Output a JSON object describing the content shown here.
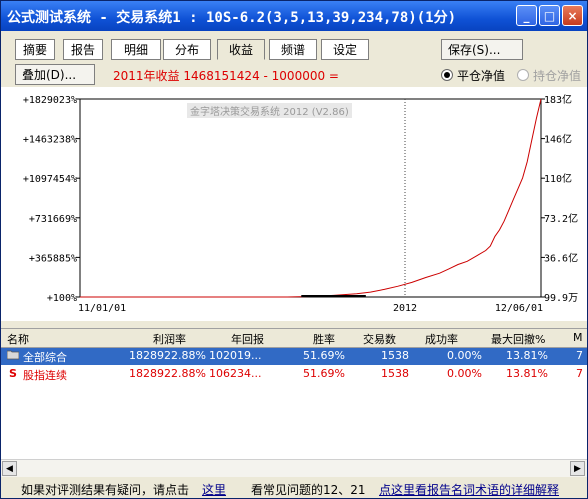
{
  "window": {
    "title": "公式测试系统 - 交易系统1 : 10S-6.2(3,5,13,39,234,78)(1分)",
    "controls": [
      "_",
      "□",
      "×"
    ]
  },
  "tabs": [
    "摘要",
    "报告",
    "明细",
    "分布",
    "收益",
    "频谱",
    "设定"
  ],
  "active_tab": "收益",
  "save_button": "保存(S)...",
  "overlay_button": "叠加(D)...",
  "income_text": "2011年收益 1468151424 - 1000000 =",
  "radio": [
    {
      "label": "平仓净值",
      "checked": true,
      "enabled": true
    },
    {
      "label": "持仓净值",
      "checked": false,
      "enabled": false
    }
  ],
  "chart_data": {
    "type": "line",
    "watermark": "金字塔决策交易系统 2012 (V2.86)",
    "y_ticks_left": [
      "+1829023%",
      "+1463238%",
      "+1097454%",
      "+731669%",
      "+365885%",
      "+100%"
    ],
    "y_ticks_right": [
      "183亿",
      "146亿",
      "110亿",
      "73.2亿",
      "36.6亿",
      "99.9万"
    ],
    "x_ticks": [
      "11/01/01",
      "2012",
      "12/06/01"
    ],
    "ylim": [
      0,
      1829023
    ],
    "x": [
      0,
      0.45,
      0.5,
      0.55,
      0.6,
      0.63,
      0.66,
      0.69,
      0.72,
      0.75,
      0.78,
      0.8,
      0.82,
      0.84,
      0.86,
      0.88,
      0.89,
      0.9,
      0.91,
      0.92,
      0.93,
      0.94,
      0.95,
      0.96,
      0.97,
      0.98,
      0.99,
      1.0
    ],
    "series": [
      {
        "color": "#cc0000",
        "values": [
          100,
          100,
          5000,
          15000,
          30000,
          45000,
          70000,
          100000,
          135000,
          180000,
          220000,
          260000,
          300000,
          330000,
          380000,
          430000,
          470000,
          560000,
          620000,
          700000,
          800000,
          900000,
          1000000,
          1100000,
          1250000,
          1450000,
          1650000,
          1829023
        ]
      }
    ],
    "grid": "vertical dotted line at 2012"
  },
  "table": {
    "columns": [
      "名称",
      "利润率",
      "年回报",
      "胜率",
      "交易数",
      "成功率",
      "最大回撤%",
      "M"
    ],
    "rows": [
      {
        "icon": "folder-icon",
        "name": "全部综合",
        "profit": "1828922.88%",
        "annual": "102019...",
        "win": "51.69%",
        "trades": "1538",
        "success": "0.00%",
        "drawdown": "13.81%",
        "m": "7"
      },
      {
        "icon": "S",
        "name": "股指连续",
        "profit": "1828922.88%",
        "annual": "106234...",
        "win": "51.69%",
        "trades": "1538",
        "success": "0.00%",
        "drawdown": "13.81%",
        "m": "7"
      }
    ]
  },
  "footer": {
    "text1": "如果对评测结果有疑问，请点击",
    "link1": "这里",
    "text2": "看常见问题的12、21",
    "link2": "点这里看报告名词术语的详细解释"
  },
  "colors": {
    "accent": "#0f52d6",
    "line": "#cc0000",
    "selected": "#316ac5"
  }
}
